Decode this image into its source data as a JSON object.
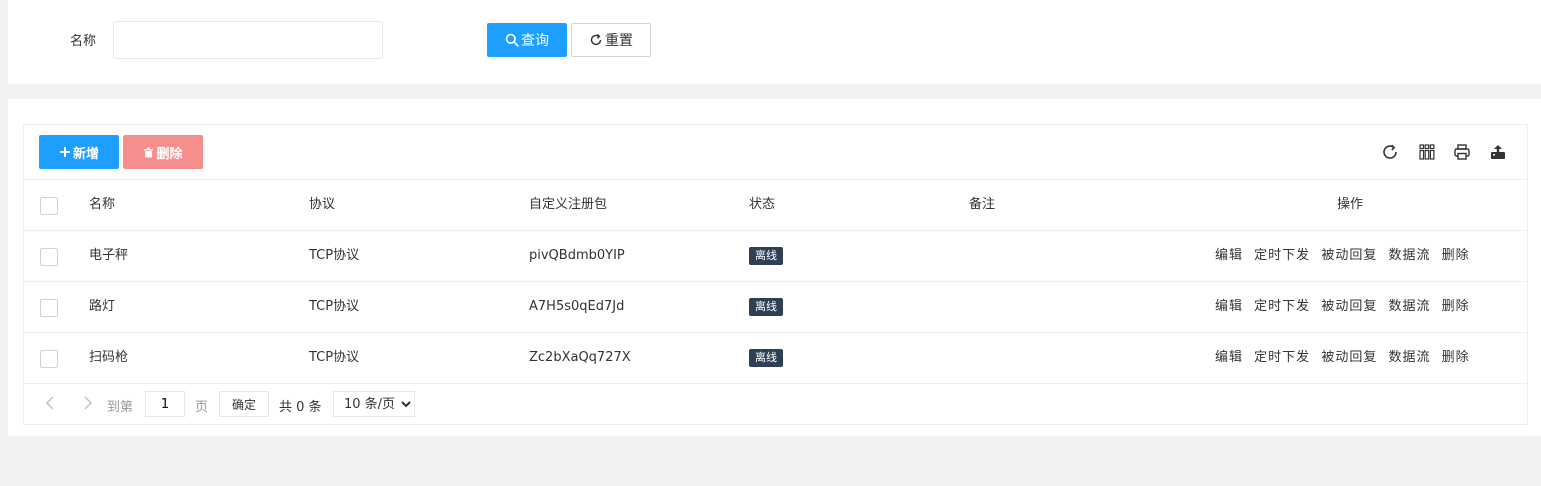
{
  "search": {
    "name_label": "名称",
    "name_value": "",
    "query_label": "查询",
    "reset_label": "重置"
  },
  "toolbar": {
    "add_label": "新增",
    "delete_label": "删除"
  },
  "table": {
    "headers": [
      "名称",
      "协议",
      "自定义注册包",
      "状态",
      "备注",
      "操作"
    ],
    "rows": [
      {
        "name": "电子秤",
        "protocol": "TCP协议",
        "register": "pivQBdmb0YIP",
        "status": "离线",
        "remark": ""
      },
      {
        "name": "路灯",
        "protocol": "TCP协议",
        "register": "A7H5s0qEd7Jd",
        "status": "离线",
        "remark": ""
      },
      {
        "name": "扫码枪",
        "protocol": "TCP协议",
        "register": "Zc2bXaQq727X",
        "status": "离线",
        "remark": ""
      }
    ],
    "actions": [
      "编辑",
      "定时下发",
      "被动回复",
      "数据流",
      "删除"
    ]
  },
  "pager": {
    "goto_label": "到第",
    "page_value": "1",
    "page_unit": "页",
    "confirm_label": "确定",
    "total_label": "共 0 条",
    "page_size": "10 条/页"
  },
  "colors": {
    "primary": "#1e9fff",
    "danger": "#f78e8e",
    "badge": "#2f4056"
  }
}
